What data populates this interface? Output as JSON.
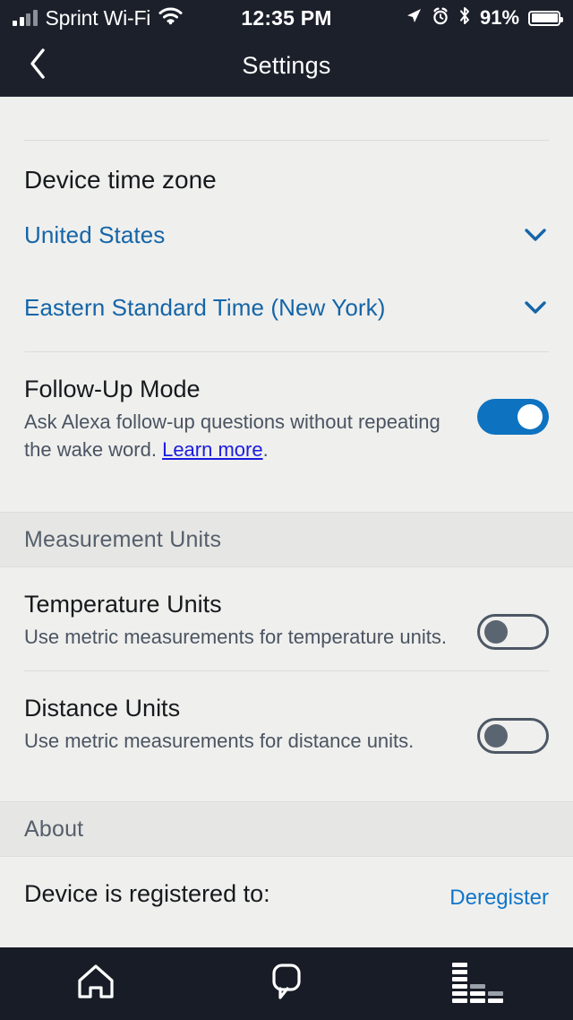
{
  "status_bar": {
    "carrier": "Sprint Wi-Fi",
    "time": "12:35 PM",
    "battery_percent": "91%",
    "icons": [
      "signal-bars-icon",
      "wifi-icon",
      "location-arrow-icon",
      "alarm-clock-icon",
      "bluetooth-icon",
      "battery-icon"
    ]
  },
  "nav": {
    "title": "Settings",
    "back_icon": "chevron-left-icon"
  },
  "timezone": {
    "heading": "Device time zone",
    "country": "United States",
    "zone": "Eastern Standard Time (New York)",
    "chevron_icon": "chevron-down-icon"
  },
  "follow_up": {
    "title": "Follow-Up Mode",
    "desc_before": "Ask Alexa follow-up questions without repeating the wake word. ",
    "link_text": "Learn more",
    "desc_after": ".",
    "toggle_state": "on"
  },
  "measurement_units": {
    "band_label": "Measurement Units",
    "items": [
      {
        "title": "Temperature Units",
        "desc": "Use metric measurements for temperature units.",
        "toggle_state": "off"
      },
      {
        "title": "Distance Units",
        "desc": "Use metric measurements for distance units.",
        "toggle_state": "off"
      }
    ]
  },
  "about": {
    "band_label": "About",
    "registered_label": "Device is registered to:",
    "deregister_label": "Deregister"
  },
  "tabbar": {
    "tabs": [
      {
        "name": "home",
        "icon": "home-icon"
      },
      {
        "name": "conversations",
        "icon": "speech-bubble-icon"
      },
      {
        "name": "activity",
        "icon": "equalizer-bars-icon"
      }
    ]
  },
  "colors": {
    "navbar_bg": "#1B202B",
    "content_bg": "#EFEFED",
    "accent_blue": "#1565A8",
    "toggle_on": "#0D72C0",
    "link_blue": "#1B1BE0",
    "band_bg": "#E6E6E4"
  }
}
